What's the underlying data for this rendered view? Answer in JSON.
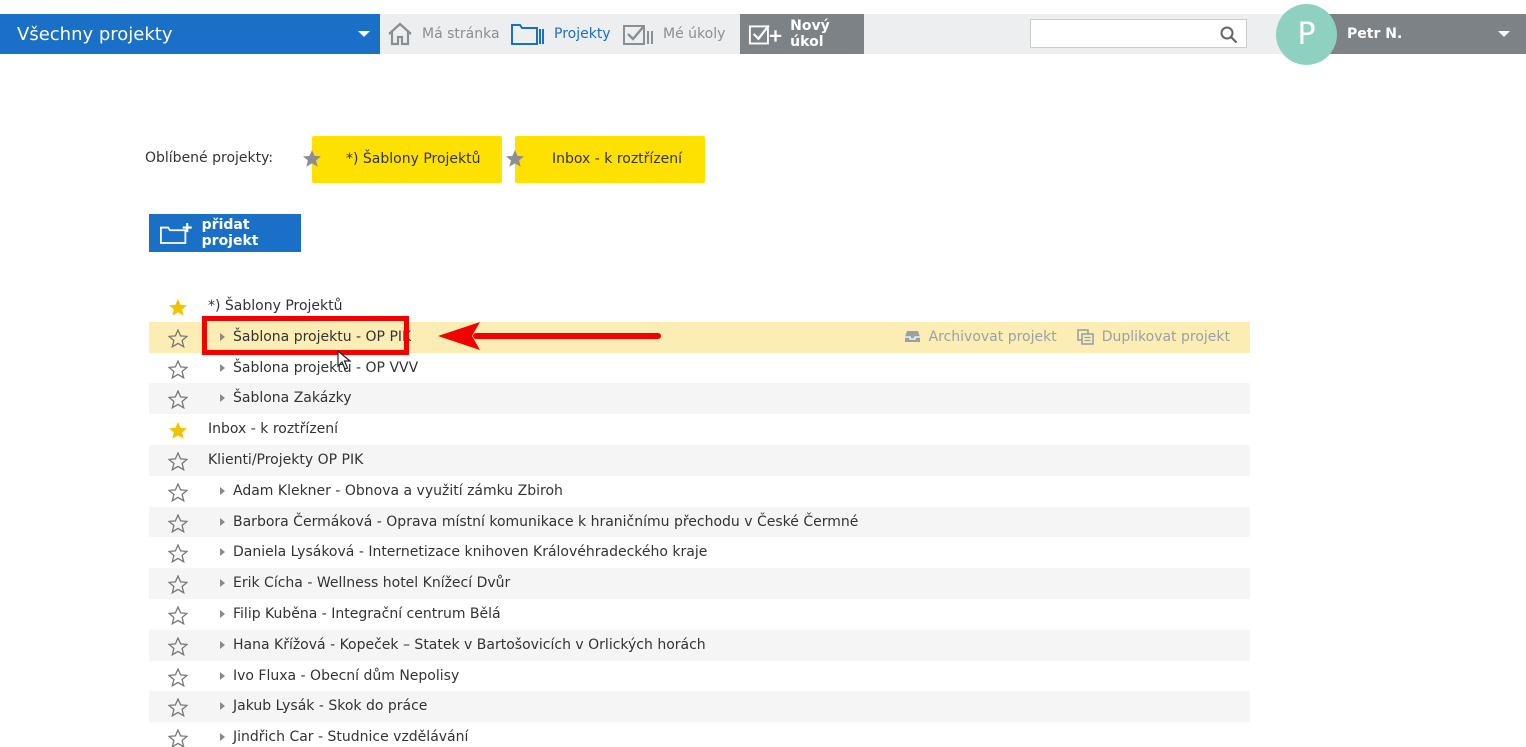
{
  "topbar": {
    "project_selector": "Všechny projekty",
    "nav": {
      "home": "Má stránka",
      "projects": "Projekty",
      "tasks": "Mé úkoly"
    },
    "new_task": "Nový úkol",
    "search": {
      "value": "",
      "placeholder": ""
    },
    "user": {
      "initial": "P",
      "name": "Petr N."
    },
    "colors": {
      "primary": "#1a6fc6",
      "topbar_bg": "#eceeef",
      "user_bg": "#7d8287",
      "avatar": "#8fd1c0"
    }
  },
  "favorites": {
    "label": "Oblíbené projekty:",
    "items": [
      "*) Šablony Projektů",
      "Inbox - k roztřízení"
    ],
    "chip_color": "#ffe100"
  },
  "add_project": "přidat projekt",
  "projects": [
    {
      "name": "*) Šablony Projektů",
      "level": 0,
      "starred": true
    },
    {
      "name": "Šablona projektu - OP PIK",
      "level": 1,
      "starred": false,
      "highlighted": true
    },
    {
      "name": "Šablona projektu - OP VVV",
      "level": 1,
      "starred": false
    },
    {
      "name": "Šablona Zakázky",
      "level": 1,
      "starred": false
    },
    {
      "name": "Inbox - k roztřízení",
      "level": 0,
      "starred": true
    },
    {
      "name": "Klienti/Projekty OP PIK",
      "level": 0,
      "starred": false
    },
    {
      "name": "Adam Klekner - Obnova a využití zámku Zbiroh",
      "level": 1,
      "starred": false
    },
    {
      "name": "Barbora Čermáková - Oprava místní komunikace k hraničnímu přechodu v České Čermné",
      "level": 1,
      "starred": false
    },
    {
      "name": "Daniela Lysáková - Internetizace knihoven Královéhradeckého kraje",
      "level": 1,
      "starred": false
    },
    {
      "name": "Erik Cícha - Wellness hotel Knížecí Dvůr",
      "level": 1,
      "starred": false
    },
    {
      "name": "Filip Kuběna - Integrační centrum Bělá",
      "level": 1,
      "starred": false
    },
    {
      "name": "Hana Křížová - Kopeček – Statek v Bartošovicích v Orlických horách",
      "level": 1,
      "starred": false
    },
    {
      "name": "Ivo Fluxa - Obecní dům Nepolisy",
      "level": 1,
      "starred": false
    },
    {
      "name": "Jakub Lysák - Skok do práce",
      "level": 1,
      "starred": false
    },
    {
      "name": "Jindřich Car - Studnice vzdělávání",
      "level": 1,
      "starred": false
    }
  ],
  "row_actions": {
    "archive": "Archivovat projekt",
    "duplicate": "Duplikovat projekt"
  },
  "annotation": {
    "color": "#f40000"
  }
}
